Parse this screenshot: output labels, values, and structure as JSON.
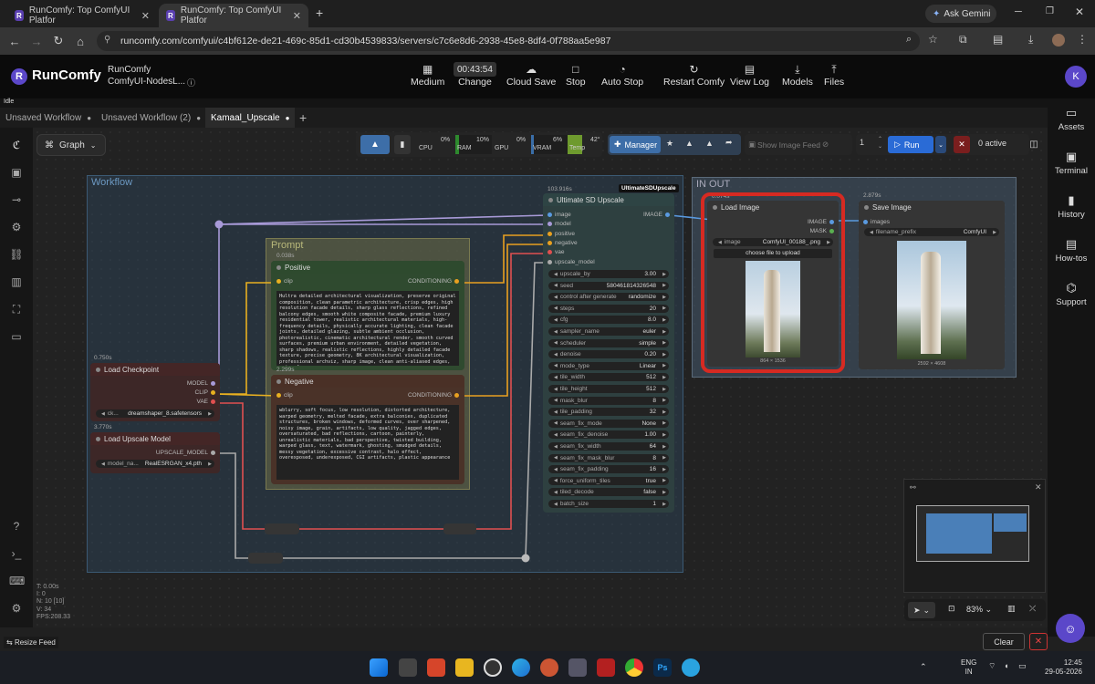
{
  "browser": {
    "tabs": [
      {
        "title": "RunComfy: Top ComfyUI Platfor",
        "active": false
      },
      {
        "title": "RunComfy: Top ComfyUI Platfor",
        "active": true
      }
    ],
    "gemini": "Ask Gemini",
    "url": "runcomfy.com/comfyui/c4bf612e-de21-469c-85d1-cd30b4539833/servers/c7c6e8d6-2938-45e8-8df4-0f788aa5e987"
  },
  "header": {
    "brand": "RunComfy",
    "app_name": "RunComfy",
    "app_sub": "ComfyUI-NodesL...",
    "timer": "00:43:54",
    "buttons": {
      "medium": "Medium",
      "change": "Change",
      "cloud_save": "Cloud Save",
      "stop": "Stop",
      "auto_stop": "Auto Stop",
      "restart": "Restart Comfy",
      "view_log": "View Log",
      "models": "Models",
      "files": "Files"
    },
    "avatar": "K"
  },
  "status": "Idle",
  "workflow_tabs": [
    {
      "label": "Unsaved Workflow",
      "active": false
    },
    {
      "label": "Unsaved Workflow (2)",
      "active": false
    },
    {
      "label": "Kamaal_Upscale",
      "active": true
    }
  ],
  "graph_label": "Graph",
  "monitor": {
    "cpu_label": "CPU",
    "cpu": "0%",
    "ram_label": "RAM",
    "ram": "10%",
    "gpu_label": "GPU",
    "gpu": "0%",
    "vram_label": "VRAM",
    "vram": "6%",
    "temp_label": "Temp",
    "temp": "42°"
  },
  "controls": {
    "manager": "Manager",
    "show_feed": "Show Image Feed",
    "queue_count": "1",
    "run": "Run",
    "active": "0 active"
  },
  "right_sidebar": {
    "assets": "Assets",
    "terminal": "Terminal",
    "history": "History",
    "howtos": "How-tos",
    "support": "Support"
  },
  "groups": {
    "workflow": "Workflow",
    "prompt": "Prompt",
    "inout": "IN OUT"
  },
  "nodes": {
    "checkpoint": {
      "time": "0.750s",
      "title": "Load Checkpoint",
      "out": [
        "MODEL",
        "CLIP",
        "VAE"
      ],
      "widget_label": "ck...",
      "widget_value": "dreamshaper_8.safetensors"
    },
    "upscale_model": {
      "time": "3.770s",
      "title": "Load Upscale Model",
      "out": "UPSCALE_MODEL",
      "widget_label": "model_na...",
      "widget_value": "RealESRGAN_x4.pth"
    },
    "positive": {
      "time": "0.038s",
      "title": "Positive",
      "in": "clip",
      "out": "CONDITIONING",
      "text": "Hultra detailed architectural visualization, preserve original composition, clean parametric architecture, crisp edges, high resolution facade details, sharp glass reflections, refined balcony edges, smooth white composite facade, premium luxury residential tower, realistic architectural materials, high-frequency details, physically accurate lighting, clean facade joints, detailed glazing, subtle ambient occlusion, photorealistic, cinematic architectural render, smooth curved surfaces, premium urban environment, detailed vegetation, sharp shadows, realistic reflections, highly detailed facade texture, precise geometry, 8K architectural visualization, professional archviz, sharp image, clean anti-aliased edges, noise free"
    },
    "negative": {
      "time": "2.299s",
      "title": "Negative",
      "in": "clip",
      "out": "CONDITIONING",
      "text": "wblurry, soft focus, low resolution, distorted architecture, warped geometry, melted facade, extra balconies, duplicated structures, broken windows, deformed curves, over sharpened, noisy image, grain, artifacts, low quality, jagged edges, oversaturated, bad reflections, cartoon, painterly, unrealistic materials, bad perspective, twisted building, warped glass, text, watermark, ghosting, smudged details, messy vegetation, excessive contrast, halo effect, overexposed, underexposed, CGI artifacts, plastic appearance"
    },
    "usd": {
      "time": "103.916s",
      "badge": "UltimateSDUpscale",
      "title": "Ultimate SD Upscale",
      "inputs": [
        "image",
        "model",
        "positive",
        "negative",
        "vae",
        "upscale_model"
      ],
      "out": "IMAGE",
      "widgets": [
        [
          "upscale_by",
          "3.00"
        ],
        [
          "seed",
          "580461814326548"
        ],
        [
          "control after generate",
          "randomize"
        ],
        [
          "steps",
          "20"
        ],
        [
          "cfg",
          "8.0"
        ],
        [
          "sampler_name",
          "euler"
        ],
        [
          "scheduler",
          "simple"
        ],
        [
          "denoise",
          "0.20"
        ],
        [
          "mode_type",
          "Linear"
        ],
        [
          "tile_width",
          "512"
        ],
        [
          "tile_height",
          "512"
        ],
        [
          "mask_blur",
          "8"
        ],
        [
          "tile_padding",
          "32"
        ],
        [
          "seam_fix_mode",
          "None"
        ],
        [
          "seam_fix_denoise",
          "1.00"
        ],
        [
          "seam_fix_width",
          "64"
        ],
        [
          "seam_fix_mask_blur",
          "8"
        ],
        [
          "seam_fix_padding",
          "16"
        ],
        [
          "force_uniform_tiles",
          "true"
        ],
        [
          "tiled_decode",
          "false"
        ],
        [
          "batch_size",
          "1"
        ]
      ]
    },
    "load_image": {
      "time": "0.074s",
      "title": "Load Image",
      "out": [
        "IMAGE",
        "MASK"
      ],
      "widget_label": "image",
      "widget_value": "ComfyUI_00188_.png",
      "upload": "choose file to upload",
      "dims": "864 × 1536"
    },
    "save_image": {
      "time": "2.879s",
      "title": "Save Image",
      "in": "images",
      "widget_label": "filename_prefix",
      "widget_value": "ComfyUI",
      "dims": "2592 × 4608"
    }
  },
  "stats": {
    "t": "T: 0.00s",
    "i": "I: 0",
    "n": "N: 10 [10]",
    "v": "V: 34",
    "fps": "FPS:208.33"
  },
  "resize_feed": "Resize Feed",
  "zoom": "83%",
  "clear": "Clear",
  "taskbar": {
    "lang1": "ENG",
    "lang2": "IN",
    "time": "12:45",
    "date": "29-05-2026"
  },
  "colors": {
    "accent": "#5b47c9",
    "run_blue": "#2a6bd6",
    "highlight_red": "#d62a22"
  }
}
